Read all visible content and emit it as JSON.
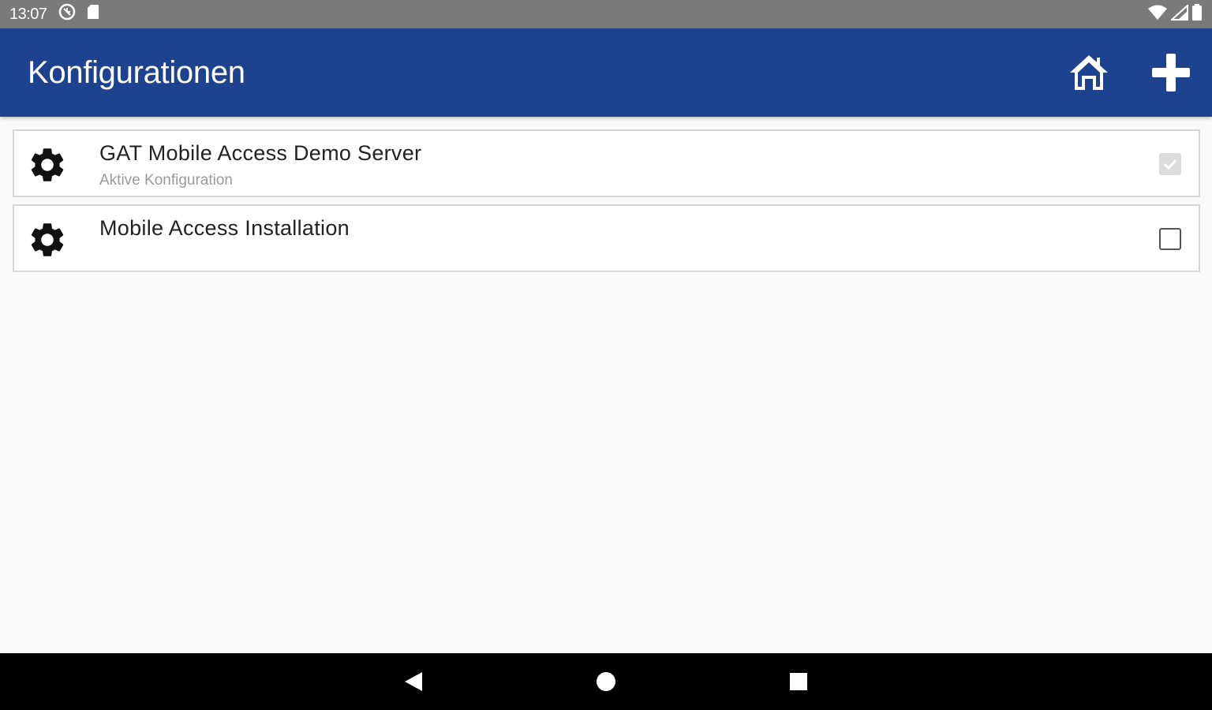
{
  "status_bar": {
    "time": "13:07",
    "left_icons": [
      "vpn-circle-icon",
      "sd-card-icon"
    ],
    "right_icons": [
      "wifi-icon",
      "signal-icon",
      "battery-icon"
    ]
  },
  "app_bar": {
    "title": "Konfigurationen",
    "actions": [
      "home-icon",
      "add-icon"
    ],
    "color": "#1e438e"
  },
  "configurations": [
    {
      "title": "GAT Mobile Access Demo Server",
      "subtitle": "Aktive Konfiguration",
      "checked": true,
      "icon": "gear-icon"
    },
    {
      "title": "Mobile Access Installation",
      "subtitle": "",
      "checked": false,
      "icon": "gear-icon"
    }
  ],
  "nav_bar": {
    "buttons": [
      "back-icon",
      "home-circle-icon",
      "recents-icon"
    ]
  }
}
